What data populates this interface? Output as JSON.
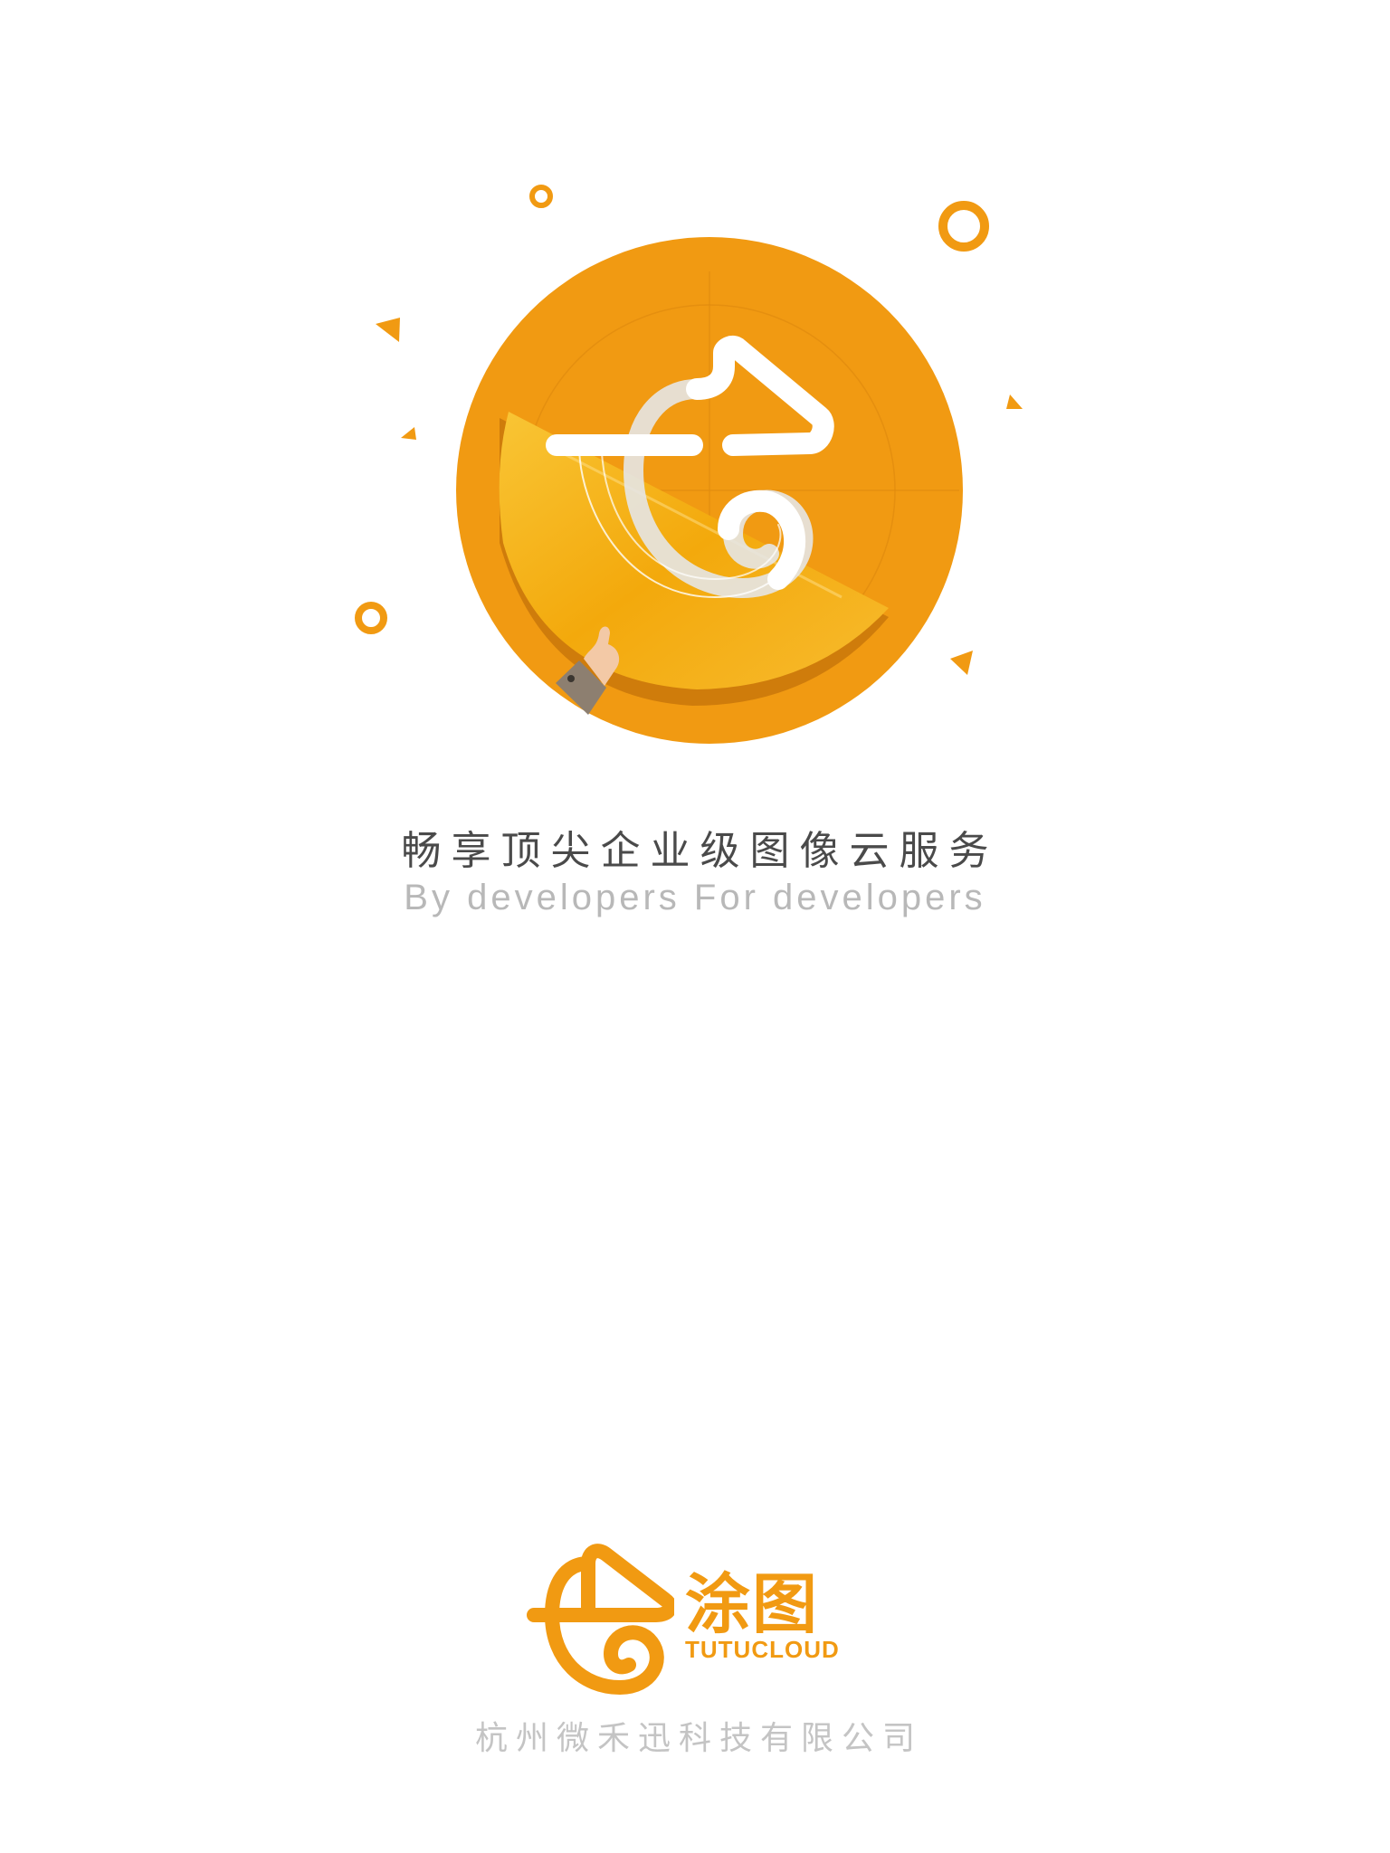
{
  "tagline": {
    "cn": "畅享顶尖企业级图像云服务",
    "en": "By developers For developers"
  },
  "brand": {
    "name_cn": "涂图",
    "name_en": "TUTUCLOUD"
  },
  "company": "杭州微禾迅科技有限公司",
  "colors": {
    "brand_orange": "#f19a12",
    "gold_light": "#f8c23a",
    "shadow_orange": "#c9770b",
    "text_dark": "#4a4a4a",
    "text_light": "#b8b8b8"
  },
  "icons": [
    "tutucloud-chameleon-logo",
    "hand-icon",
    "ring-decoration",
    "triangle-decoration"
  ]
}
